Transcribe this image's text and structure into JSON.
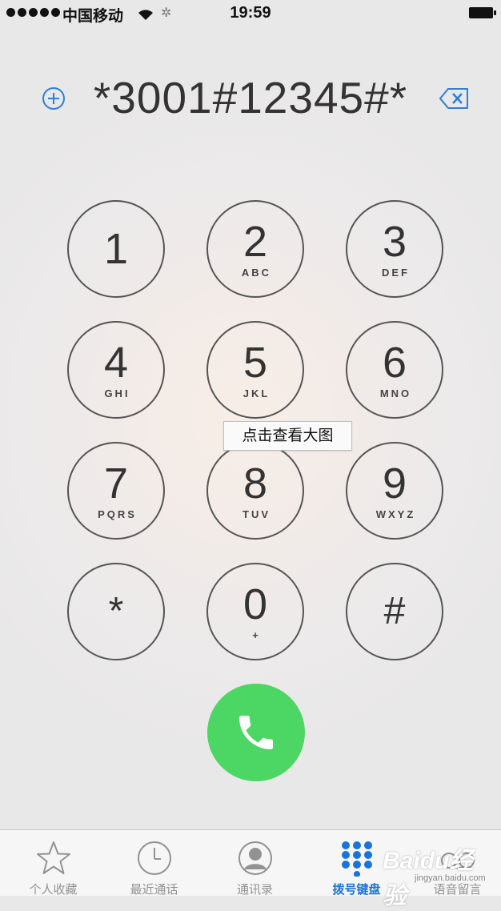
{
  "status_bar": {
    "carrier": "中国移动",
    "time": "19:59"
  },
  "dialer": {
    "number": "*3001#12345#*",
    "keys": [
      {
        "digit": "1",
        "letters": ""
      },
      {
        "digit": "2",
        "letters": "ABC"
      },
      {
        "digit": "3",
        "letters": "DEF"
      },
      {
        "digit": "4",
        "letters": "GHI"
      },
      {
        "digit": "5",
        "letters": "JKL"
      },
      {
        "digit": "6",
        "letters": "MNO"
      },
      {
        "digit": "7",
        "letters": "PQRS"
      },
      {
        "digit": "8",
        "letters": "TUV"
      },
      {
        "digit": "9",
        "letters": "WXYZ"
      },
      {
        "digit": "*",
        "letters": ""
      },
      {
        "digit": "0",
        "letters": "+"
      },
      {
        "digit": "#",
        "letters": ""
      }
    ]
  },
  "tooltip": "点击查看大图",
  "call_button_color": "#4cd764",
  "tab_bar": {
    "active_color": "#1a73d9",
    "tabs": [
      {
        "label": "个人收藏",
        "icon": "star-icon"
      },
      {
        "label": "最近通话",
        "icon": "clock-icon"
      },
      {
        "label": "通讯录",
        "icon": "contacts-icon"
      },
      {
        "label": "拨号键盘",
        "icon": "keypad-icon"
      },
      {
        "label": "语音留言",
        "icon": "voicemail-icon"
      }
    ]
  },
  "watermark": {
    "logo": "Baidu经验",
    "url": "jingyan.baidu.com"
  }
}
